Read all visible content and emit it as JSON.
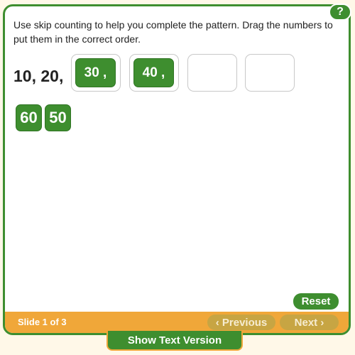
{
  "help": {
    "label": "?"
  },
  "instructions": "Use skip counting to help you complete the pattern. Drag the numbers to put them in the correct order.",
  "pattern": {
    "prefix": "10, 20,",
    "slots": [
      {
        "value": "30 ,"
      },
      {
        "value": "40 ,"
      },
      {
        "value": ""
      },
      {
        "value": ""
      }
    ]
  },
  "bank": [
    "60",
    "50"
  ],
  "controls": {
    "reset_label": "Reset"
  },
  "footer": {
    "slide_label": "Slide 1 of 3",
    "previous_label": "‹ Previous",
    "next_label": "Next ›"
  },
  "text_version_label": "Show Text Version",
  "colors": {
    "accent": "#3e8e2f",
    "footer": "#f0a739",
    "nav_disabled": "#c7a543"
  }
}
